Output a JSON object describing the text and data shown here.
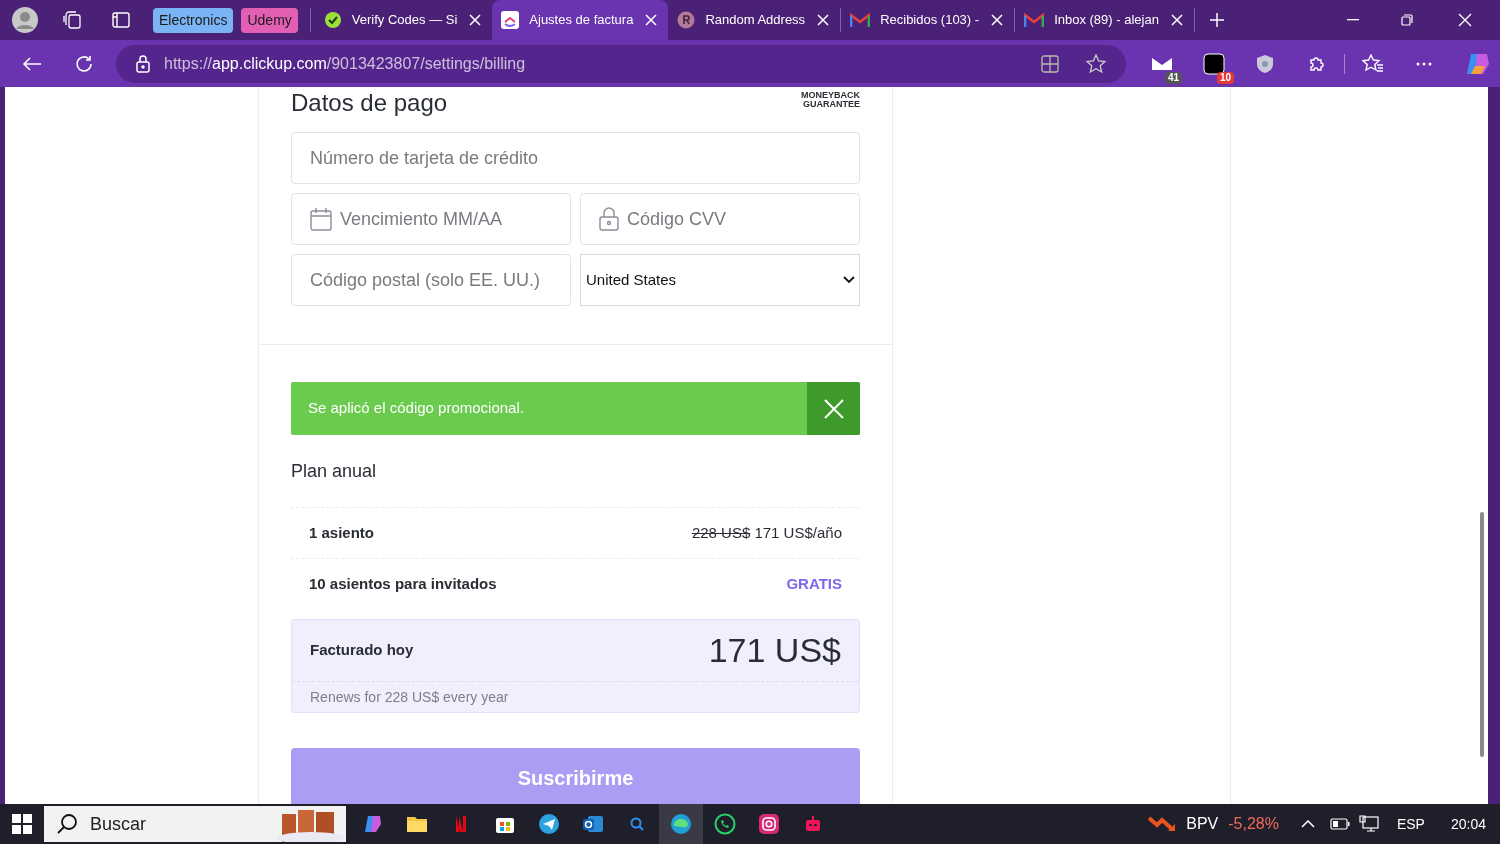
{
  "browser": {
    "tab_groups": [
      {
        "label": "Electronics",
        "color": "#7ab4f5"
      },
      {
        "label": "Udemy",
        "color": "#e35fb3"
      }
    ],
    "tabs": [
      {
        "title": "Verify Codes — Si",
        "kind": "check",
        "selected": false
      },
      {
        "title": "Ajustes de factura",
        "kind": "clickup",
        "selected": true
      },
      {
        "title": "Random Address",
        "kind": "letter",
        "selected": false
      },
      {
        "title": "Recibidos (103) -",
        "kind": "mail",
        "selected": false
      },
      {
        "title": "Inbox (89) - alejan",
        "kind": "mail",
        "selected": false
      }
    ],
    "url": {
      "scheme": "https://",
      "host": "app.clickup.com",
      "path": "/9013423807/settings/billing"
    },
    "extension_badges": [
      "41",
      "10"
    ]
  },
  "page": {
    "heading": "Datos de pago",
    "guarantee": [
      "MONEYBACK",
      "GUARANTEE"
    ],
    "card_number": {
      "placeholder": "Número de tarjeta de crédito"
    },
    "expiry": {
      "placeholder": "Vencimiento MM/AA"
    },
    "cvv": {
      "placeholder": "Código CVV"
    },
    "postal": {
      "placeholder": "Código postal (solo EE. UU.)"
    },
    "country": {
      "value": "United States"
    },
    "promo": {
      "message": "Se aplicó el código promocional."
    },
    "plan_title": "Plan anual",
    "line_items": [
      {
        "label": "1 asiento",
        "old_price": "228 US$",
        "price": "171 US$/año",
        "kind": "paid"
      },
      {
        "label": "10 asientos para invitados",
        "price": "GRATIS",
        "kind": "free"
      }
    ],
    "total": {
      "label": "Facturado hoy",
      "amount": "171 US$",
      "note": "Renews for 228 US$ every year"
    },
    "subscribe": "Suscribirme"
  },
  "taskbar": {
    "search": {
      "placeholder": "Buscar"
    },
    "stock": {
      "symbol": "BPV",
      "change": "-5,28%"
    },
    "language": "ESP",
    "time": "20:04"
  }
}
